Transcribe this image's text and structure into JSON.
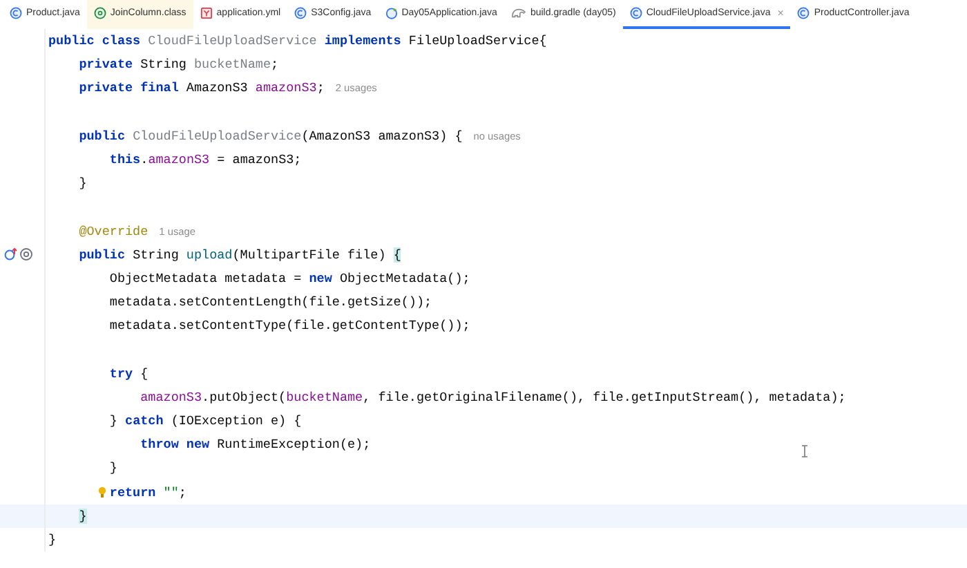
{
  "tabs": [
    {
      "label": "Product.java",
      "kind": "class",
      "library": false,
      "selected": false
    },
    {
      "label": "JoinColumn.class",
      "kind": "annotation",
      "library": true,
      "selected": false
    },
    {
      "label": "application.yml",
      "kind": "yaml",
      "library": false,
      "selected": false
    },
    {
      "label": "S3Config.java",
      "kind": "class",
      "library": false,
      "selected": false
    },
    {
      "label": "Day05Application.java",
      "kind": "boot",
      "library": false,
      "selected": false
    },
    {
      "label": "build.gradle (day05)",
      "kind": "gradle",
      "library": false,
      "selected": false
    },
    {
      "label": "CloudFileUploadService.java",
      "kind": "class",
      "library": false,
      "selected": true,
      "close": "×"
    },
    {
      "label": "ProductController.java",
      "kind": "class",
      "library": false,
      "selected": false
    }
  ],
  "editor": {
    "lines": [
      {
        "current": false,
        "tokens": [
          {
            "kind": "keyword",
            "text": "public class "
          },
          {
            "kind": "unused",
            "text": "CloudFileUploadService"
          },
          {
            "kind": "keyword",
            "text": " implements "
          },
          {
            "kind": "plain",
            "text": "FileUploadService{"
          }
        ]
      },
      {
        "current": false,
        "tokens": [
          {
            "kind": "keyword",
            "text": "    private "
          },
          {
            "kind": "plain",
            "text": "String "
          },
          {
            "kind": "unused",
            "text": "bucketName"
          },
          {
            "kind": "plain",
            "text": ";"
          }
        ]
      },
      {
        "current": false,
        "tokens": [
          {
            "kind": "keyword",
            "text": "    private final "
          },
          {
            "kind": "plain",
            "text": "AmazonS3 "
          },
          {
            "kind": "field",
            "text": "amazonS3"
          },
          {
            "kind": "plain",
            "text": ";"
          }
        ],
        "hint": "2 usages"
      },
      {
        "current": false
      },
      {
        "current": false,
        "tokens": [
          {
            "kind": "keyword",
            "text": "    public "
          },
          {
            "kind": "unused",
            "text": "CloudFileUploadService"
          },
          {
            "kind": "plain",
            "text": "(AmazonS3 amazonS3) {"
          }
        ],
        "hint": "no usages"
      },
      {
        "current": false,
        "tokens": [
          {
            "kind": "keyword",
            "text": "        this"
          },
          {
            "kind": "plain",
            "text": "."
          },
          {
            "kind": "field",
            "text": "amazonS3"
          },
          {
            "kind": "plain",
            "text": " = amazonS3;"
          }
        ]
      },
      {
        "current": false,
        "tokens": [
          {
            "kind": "plain",
            "text": "    }"
          }
        ]
      },
      {
        "current": false
      },
      {
        "current": false,
        "tokens": [
          {
            "kind": "annotation",
            "text": "    @Override"
          }
        ],
        "hint": "1 usage"
      },
      {
        "current": false,
        "implements": true,
        "tokens": [
          {
            "kind": "keyword",
            "text": "    public "
          },
          {
            "kind": "plain",
            "text": "String "
          },
          {
            "kind": "method",
            "text": "upload"
          },
          {
            "kind": "plain",
            "text": "(MultipartFile file) "
          },
          {
            "kind": "brace",
            "text": "{"
          }
        ]
      },
      {
        "current": false,
        "tokens": [
          {
            "kind": "plain",
            "text": "        ObjectMetadata metadata = "
          },
          {
            "kind": "keyword",
            "text": "new "
          },
          {
            "kind": "plain",
            "text": "ObjectMetadata();"
          }
        ]
      },
      {
        "current": false,
        "tokens": [
          {
            "kind": "plain",
            "text": "        metadata.setContentLength(file.getSize());"
          }
        ]
      },
      {
        "current": false,
        "tokens": [
          {
            "kind": "plain",
            "text": "        metadata.setContentType(file.getContentType());"
          }
        ]
      },
      {
        "current": false
      },
      {
        "current": false,
        "tokens": [
          {
            "kind": "keyword",
            "text": "        try "
          },
          {
            "kind": "plain",
            "text": "{"
          }
        ]
      },
      {
        "current": false,
        "tokens": [
          {
            "kind": "field",
            "text": "            amazonS3"
          },
          {
            "kind": "plain",
            "text": ".putObject("
          },
          {
            "kind": "field",
            "text": "bucketName"
          },
          {
            "kind": "plain",
            "text": ", file.getOriginalFilename(), file.getInputStream(), metadata);"
          }
        ]
      },
      {
        "current": false,
        "tokens": [
          {
            "kind": "plain",
            "text": "        } "
          },
          {
            "kind": "keyword",
            "text": "catch "
          },
          {
            "kind": "plain",
            "text": "(IOException e) {"
          }
        ]
      },
      {
        "current": false,
        "tokens": [
          {
            "kind": "keyword",
            "text": "            throw new "
          },
          {
            "kind": "plain",
            "text": "RuntimeException(e);"
          }
        ]
      },
      {
        "current": false,
        "tokens": [
          {
            "kind": "plain",
            "text": "        }"
          }
        ]
      },
      {
        "current": false,
        "bulb": true,
        "tokens": [
          {
            "kind": "keyword",
            "text": "        return "
          },
          {
            "kind": "string",
            "text": "\"\""
          },
          {
            "kind": "plain",
            "text": ";"
          }
        ]
      },
      {
        "current": true,
        "tokens": [
          {
            "kind": "brace",
            "text": "    }"
          }
        ]
      },
      {
        "current": false,
        "tokens": [
          {
            "kind": "plain",
            "text": "}"
          }
        ]
      }
    ]
  }
}
